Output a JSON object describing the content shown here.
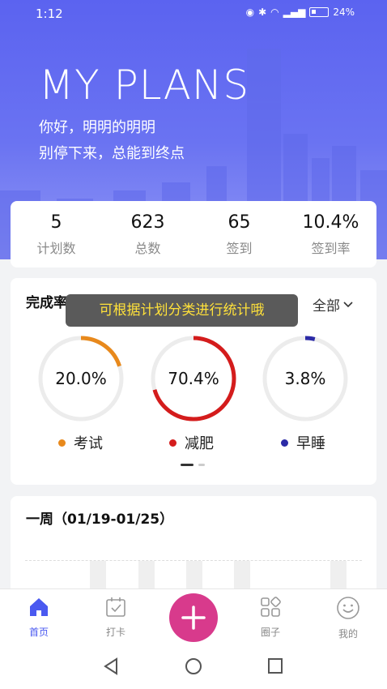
{
  "status_bar": {
    "time": "1:12",
    "battery": "24%"
  },
  "hero": {
    "title": "MY PLANS",
    "greeting": "你好，明明的明明",
    "motto": "别停下来，总能到终点"
  },
  "stats": [
    {
      "value": "5",
      "label": "计划数"
    },
    {
      "value": "623",
      "label": "总数"
    },
    {
      "value": "65",
      "label": "签到"
    },
    {
      "value": "10.4%",
      "label": "签到率"
    }
  ],
  "completion": {
    "title": "完成率",
    "filter_label": "全部",
    "tooltip": "可根据计划分类进行统计哦",
    "items": [
      {
        "name": "考试",
        "percent_text": "20.0%",
        "fraction": 0.2,
        "color": "#e8891c"
      },
      {
        "name": "减肥",
        "percent_text": "70.4%",
        "fraction": 0.704,
        "color": "#d41c1c"
      },
      {
        "name": "早睡",
        "percent_text": "3.8%",
        "fraction": 0.038,
        "color": "#2b2aa6"
      }
    ]
  },
  "week": {
    "title": "一周（01/19-01/25）"
  },
  "tabs": [
    {
      "label": "首页",
      "icon": "home-icon",
      "active": true
    },
    {
      "label": "打卡",
      "icon": "calendar-check-icon",
      "active": false
    },
    {
      "label": "",
      "icon": "plus-icon",
      "active": false
    },
    {
      "label": "圈子",
      "icon": "apps-grid-icon",
      "active": false
    },
    {
      "label": "我的",
      "icon": "smiley-face-icon",
      "active": false
    }
  ],
  "colors": {
    "accent": "#4a59f0",
    "fab": "#d83a8c",
    "hero": "#5b63f0"
  }
}
